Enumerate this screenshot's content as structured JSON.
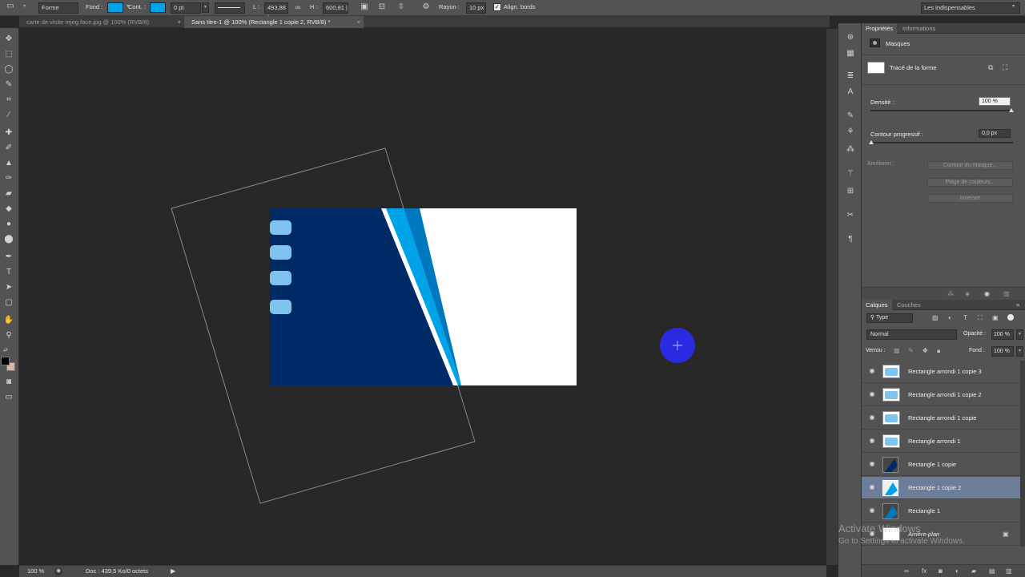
{
  "options_bar": {
    "tool_mode": "Forme",
    "fill_label": "Fond :",
    "stroke_label": "Cont. :",
    "stroke_width": "0 pt",
    "width_label": "L :",
    "width_value": "493,88 |",
    "height_label": "H :",
    "height_value": "600,81 |",
    "radius_label": "Rayon :",
    "radius_value": "10 px",
    "align_edges_label": "Align. bords",
    "align_edges_checked": true,
    "workspace": "Les indispensables",
    "fill_color": "#00a2e8",
    "stroke_color": "#00a2e8"
  },
  "doc_tabs": [
    {
      "label": "carte de visite rejeg face.jpg @ 100% (RVB/8)",
      "active": false
    },
    {
      "label": "Sans titre-1 @ 100% (Rectangle 1 copie 2, RVB/8) *",
      "active": true
    }
  ],
  "status_bar": {
    "zoom": "100 %",
    "doc_info": "Doc : 439,5 Ko/0 octets"
  },
  "properties_panel": {
    "tabs": [
      {
        "label": "Propriétés",
        "active": true
      },
      {
        "label": "Informations",
        "active": false
      }
    ],
    "section_title": "Masques",
    "shape_path_label": "Tracé de la forme",
    "density_label": "Densité :",
    "density_value": "100 %",
    "feather_label": "Contour progressif :",
    "feather_value": "0,0 px",
    "refine_label": "Améliorer :",
    "mask_edge_button": "Contour du masque...",
    "color_range_button": "Plage de couleurs...",
    "invert_button": "Inverser"
  },
  "layers_panel": {
    "tabs": [
      {
        "label": "Calques",
        "active": true
      },
      {
        "label": "Couches",
        "active": false
      }
    ],
    "filter_type": "Type",
    "blend_mode": "Normal",
    "opacity_label": "Opacité :",
    "opacity_value": "100 %",
    "lock_label": "Verrou :",
    "fill_label": "Fond :",
    "fill_value": "100 %",
    "layers": [
      {
        "name": "Rectangle arrondi 1 copie 3",
        "selected": false,
        "kind": "rounded"
      },
      {
        "name": "Rectangle arrondi 1 copie 2",
        "selected": false,
        "kind": "rounded"
      },
      {
        "name": "Rectangle arrondi 1 copie",
        "selected": false,
        "kind": "rounded"
      },
      {
        "name": "Rectangle arrondi 1",
        "selected": false,
        "kind": "rounded"
      },
      {
        "name": "Rectangle 1 copie",
        "selected": false,
        "kind": "navy"
      },
      {
        "name": "Rectangle 1 copie 2",
        "selected": true,
        "kind": "cyan"
      },
      {
        "name": "Rectangle 1",
        "selected": false,
        "kind": "blue"
      },
      {
        "name": "Arrière-plan",
        "selected": false,
        "kind": "background"
      }
    ]
  },
  "watermark": {
    "line1": "Activate Windows",
    "line2": "Go to Settings to activate Windows."
  },
  "colors": {
    "navy": "#002a66",
    "cyan": "#00a2e8",
    "mid_blue": "#0078bf",
    "pill": "#7fc4ef",
    "cursor": "#2a2ae0",
    "selected_layer": "#6b7d99"
  }
}
